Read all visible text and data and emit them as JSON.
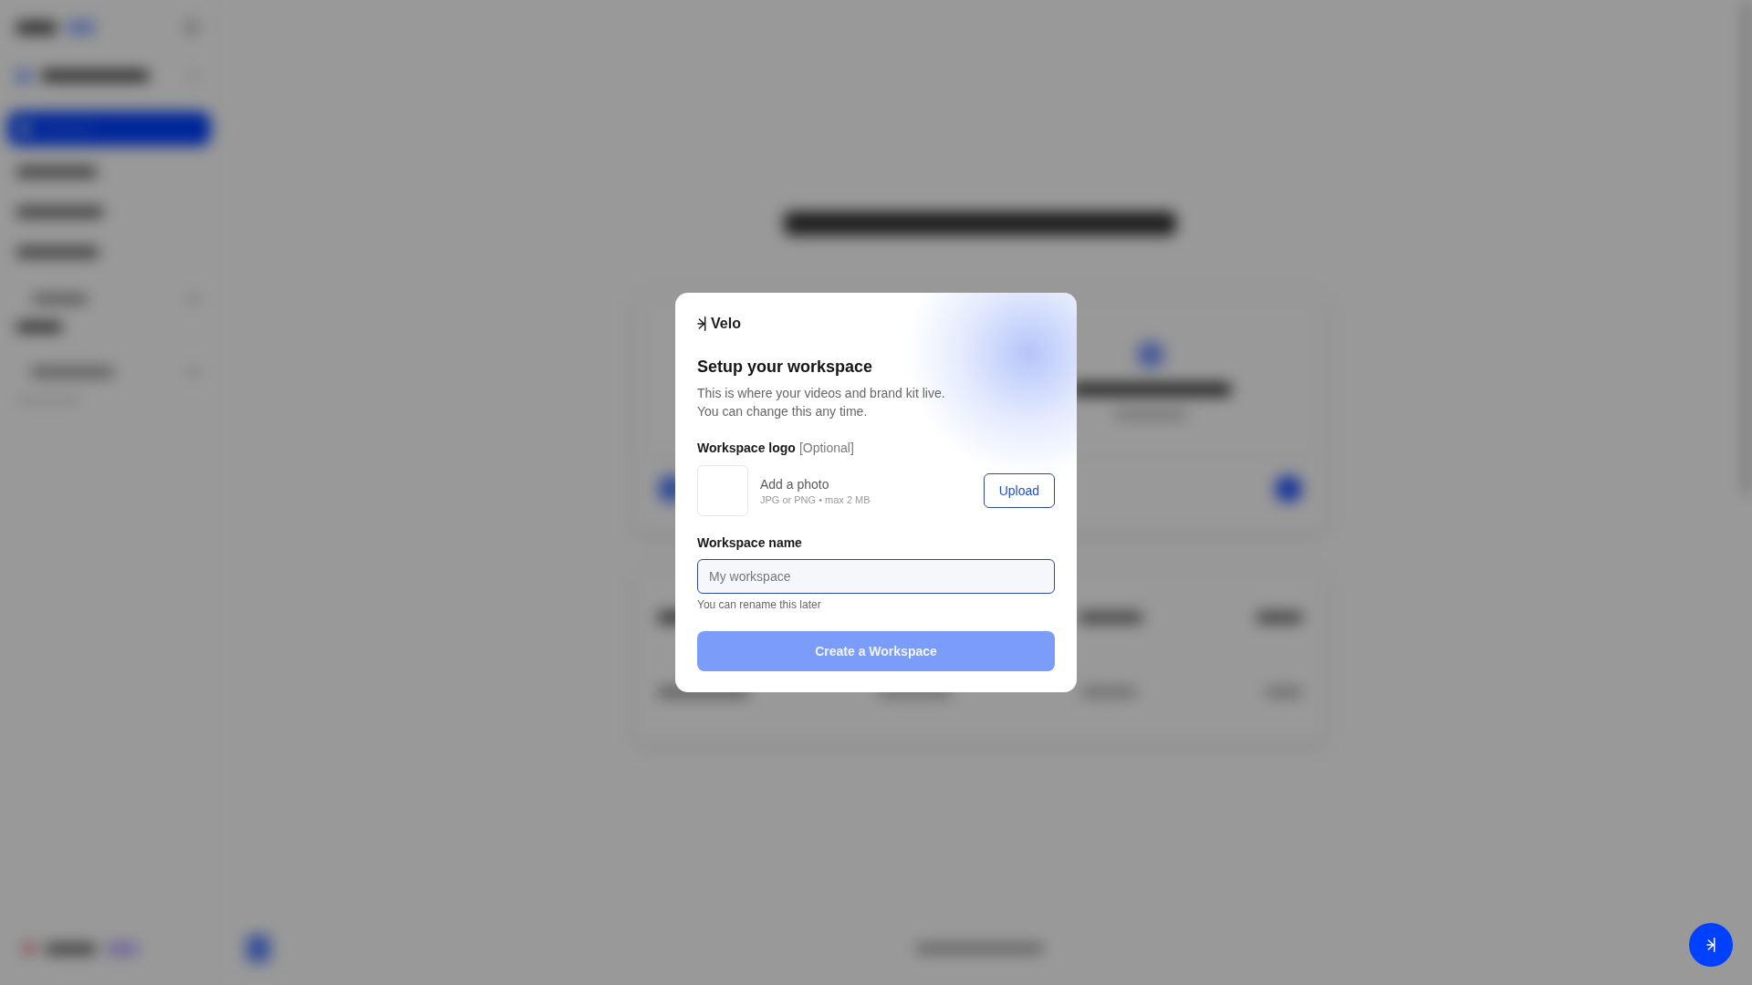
{
  "dialog": {
    "brand": "Velo",
    "title": "Setup your workspace",
    "description": [
      "This is where your videos and brand kit live.",
      "You can change this any time."
    ],
    "logo_field": {
      "label": "Workspace logo",
      "optional": "[Optional]",
      "prompt": "Add a photo",
      "hint": "JPG or PNG • max 2 MB",
      "button": "Upload"
    },
    "name_field": {
      "label": "Workspace name",
      "placeholder": "My workspace",
      "helper": "You can rename this later"
    },
    "submit": {
      "label": "Create a Workspace",
      "disabled": true
    }
  }
}
